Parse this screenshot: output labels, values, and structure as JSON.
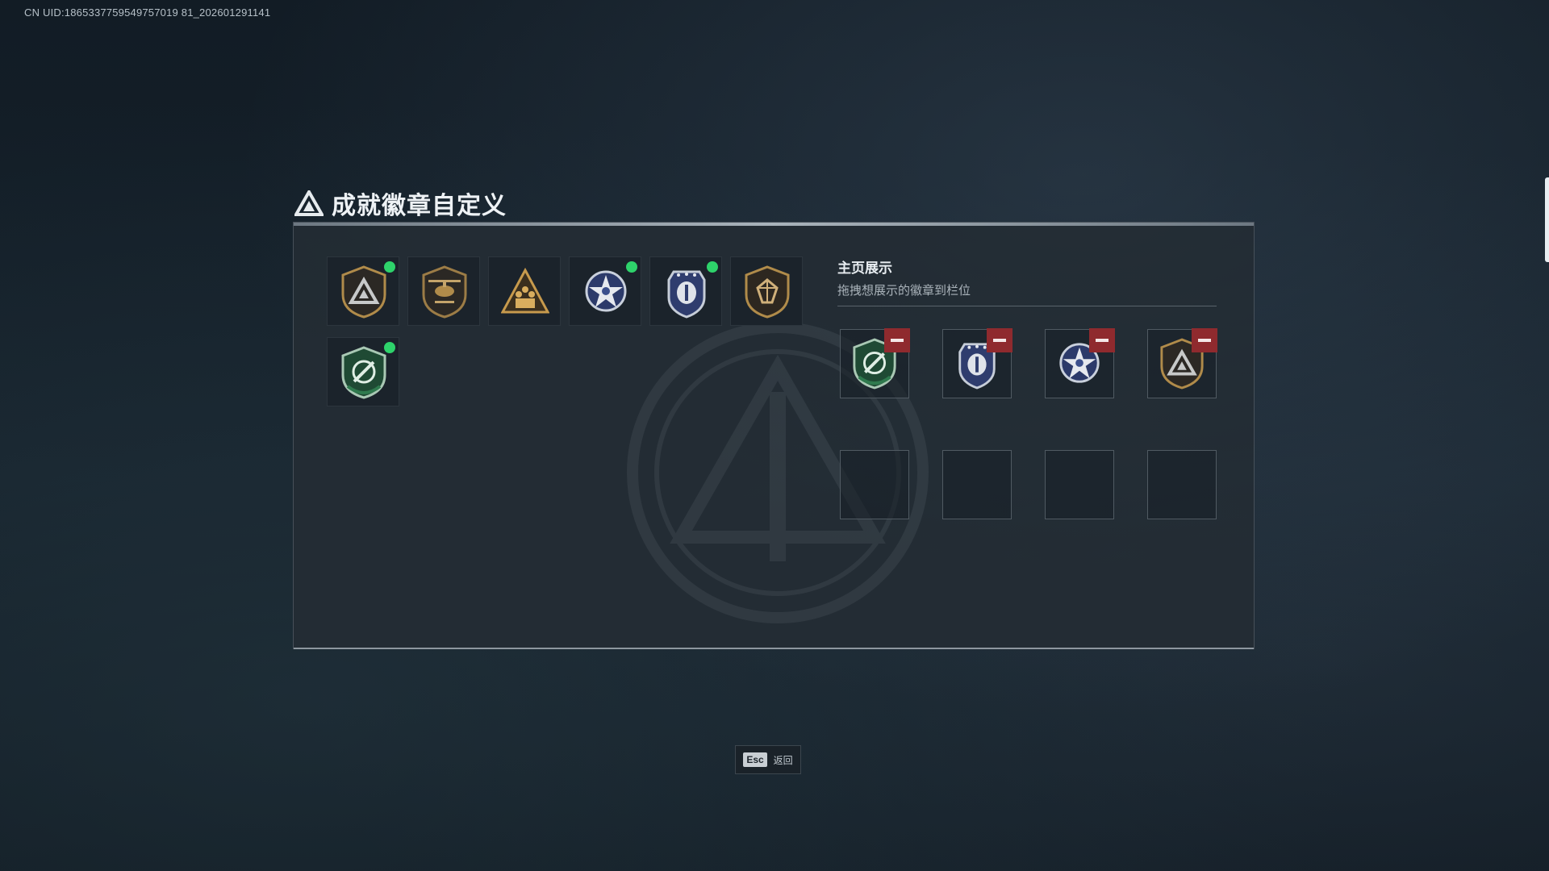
{
  "uid_text": "CN UID:1865337759549757019 81_202601291141",
  "panel": {
    "title": "成就徽章自定义"
  },
  "badges": [
    {
      "name": "triangle-shield-badge-icon",
      "equipped": true
    },
    {
      "name": "helicopter-shield-badge-icon",
      "equipped": false
    },
    {
      "name": "soldiers-triangle-badge-icon",
      "equipped": false
    },
    {
      "name": "star-winged-badge-icon",
      "equipped": true
    },
    {
      "name": "police-shield-badge-icon",
      "equipped": true
    },
    {
      "name": "gem-shield-badge-icon",
      "equipped": false
    },
    {
      "name": "green-cycle-shield-badge-icon",
      "equipped": true
    }
  ],
  "display": {
    "title": "主页展示",
    "subtitle": "拖拽想展示的徽章到栏位",
    "slots": [
      {
        "badge": "green-cycle-shield-badge-icon"
      },
      {
        "badge": "police-shield-badge-icon"
      },
      {
        "badge": "star-winged-badge-icon"
      },
      {
        "badge": "triangle-shield-badge-icon"
      },
      {
        "badge": ""
      },
      {
        "badge": ""
      },
      {
        "badge": ""
      },
      {
        "badge": ""
      }
    ]
  },
  "footer": {
    "key": "Esc",
    "label": "返回"
  },
  "colors": {
    "equipped_dot": "#2ed36b",
    "remove_button": "#8f2a2e",
    "gold": "#b08b4a",
    "navy": "#3b4f8c",
    "green": "#2f7a4e"
  }
}
